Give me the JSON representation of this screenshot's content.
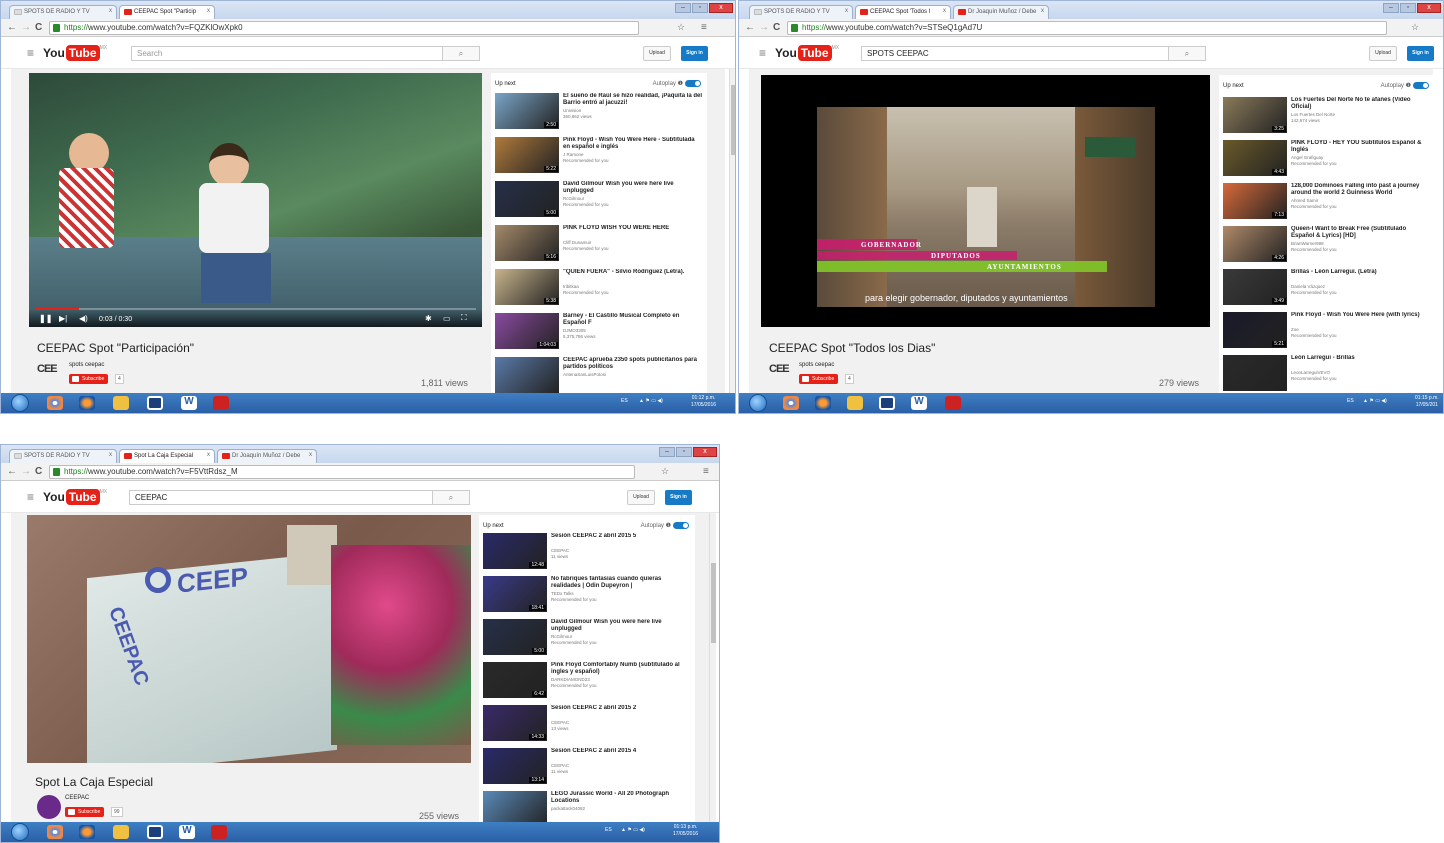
{
  "shot1": {
    "tabs": [
      "SPOTS DE RADIO Y TV",
      "CEEPAC Spot \"Particip"
    ],
    "url_https": "https://",
    "url_rest": "www.youtube.com/watch?v=FQZKlOwXpk0",
    "search_placeholder": "Search",
    "search_button_icon": "search-icon",
    "logo_you": "You",
    "logo_tube": "Tube",
    "logo_region": "MX",
    "upload": "Upload",
    "signin": "Sign in",
    "player": {
      "time": "0:03 / 0:30",
      "progress": 0.1
    },
    "video_title": "CEEPAC Spot \"Participación\"",
    "channel_logo": "CEE",
    "channel": "spots ceepac",
    "subscribe": "Subscribe",
    "subscribers": "4",
    "views": "1,811 views",
    "up_next": "Up next",
    "autoplay": "Autoplay",
    "items": [
      {
        "title": "El sueño de Raúl se hizo realidad, ¡Paquita la del Barrio entró al jacuzzi!",
        "channel": "Univision",
        "meta": "360,862 views",
        "dur": "2:50",
        "color": "#7aa6c8"
      },
      {
        "title": "Pink Floyd - Wish You Were Here - Subtitulada en español e inglés",
        "channel": "J Ramone",
        "meta": "Recommended for you",
        "dur": "5:22",
        "color": "#b07a3c"
      },
      {
        "title": "David Gilmour Wish you were here live unplugged",
        "channel": "RcGilmour",
        "meta": "Recommended for you",
        "dur": "5:00",
        "color": "#27304a"
      },
      {
        "title": "PINK FLOYD WISH YOU WERE HERE",
        "channel": "Cliff Dunamuir",
        "meta": "Recommended for you",
        "dur": "5:16",
        "color": "#a48a6a"
      },
      {
        "title": "\"QUIEN FUERA\" - Silvio Rodríguez (Letra).",
        "channel": "tribitkaa",
        "meta": "Recommended for you",
        "dur": "5:38",
        "color": "#c8b48c"
      },
      {
        "title": "Barney - El Castillo Musical Completo en Español F",
        "channel": "DJMO3305",
        "meta": "5,375,786 views",
        "dur": "1:04:03",
        "color": "#8a4aa0"
      },
      {
        "title": "CEEPAC aprueba 2350 spots publicitarios para partidos políticos",
        "channel": "AntenaSanLuisPotosi",
        "meta": "",
        "dur": "",
        "color": "#5a7aa8"
      }
    ],
    "tray": "ES",
    "clock_time": "01:12 p.m.",
    "clock_date": "17/05/2016"
  },
  "shot2": {
    "tabs": [
      "SPOTS DE RADIO Y TV",
      "CEEPAC Spot 'Todos l",
      "Dr Joaquín Muñoz / Debe"
    ],
    "url_https": "https://",
    "url_rest": "www.youtube.com/watch?v=STSeQ1gAd7U",
    "search_value": "SPOTS CEEPAC",
    "upload": "Upload",
    "signin": "Sign in",
    "overlay": {
      "l1": "GOBERNADOR",
      "l2": "DIPUTADOS",
      "l3": "AYUNTAMIENTOS",
      "subtitle": "para elegir gobernador, diputados y ayuntamientos"
    },
    "video_title": "CEEPAC Spot \"Todos los Dias\"",
    "channel_logo": "CEE",
    "channel": "spots ceepac",
    "subscribe": "Subscribe",
    "subscribers": "4",
    "views": "279 views",
    "up_next": "Up next",
    "autoplay": "Autoplay",
    "items": [
      {
        "title": "Los Fuertes Del Norte No te afanes (Video Oficial)",
        "channel": "Los Fuertes Del Norte",
        "meta": "142,674 views",
        "dur": "3:25",
        "color": "#8a7a5a"
      },
      {
        "title": "PINK FLOYD - HEY YOU Subtitulos Español & Inglés",
        "channel": "Angel Grafiguay",
        "meta": "Recommended for you",
        "dur": "4:43",
        "color": "#6a5a2a"
      },
      {
        "title": "128,000 Dominoes Falling into past a journey around the world 2 Guinness World",
        "channel": "Ahmed Samir",
        "meta": "Recommended for you",
        "dur": "7:13",
        "color": "#d86a3a"
      },
      {
        "title": "Queen-I Want to Break Free (Subtitulado Español & Lyrics) [HD]",
        "channel": "BrianWarner998",
        "meta": "Recommended for you",
        "dur": "4:26",
        "color": "#b08a6a"
      },
      {
        "title": "Brillas - León Larregui. (Letra)",
        "channel": "Daniela Vázquez",
        "meta": "Recommended for you",
        "dur": "3:49",
        "color": "#3a3a3a"
      },
      {
        "title": "Pink Floyd - Wish You Were Here (with lyrics)",
        "channel": "Zoe",
        "meta": "Recommended for you",
        "dur": "5:21",
        "color": "#1a1a2a"
      },
      {
        "title": "León Larregui - Brillas",
        "channel": "LeonLarreguiVEVO",
        "meta": "Recommended for you",
        "dur": "",
        "color": "#2a2a2a"
      }
    ],
    "tray": "ES",
    "clock_time": "01:15 p.m.",
    "clock_date": "17/05/201"
  },
  "shot3": {
    "tabs": [
      "SPOTS DE RADIO Y TV",
      "Spot La Caja Especial",
      "Dr Joaquín Muñoz / Debe"
    ],
    "url_https": "https://",
    "url_rest": "www.youtube.com/watch?v=F5VttRdsz_M",
    "search_value": "CEEPAC",
    "upload": "Upload",
    "signin": "Sign in",
    "box_text": "CEEP",
    "box_side_text": "CEEPAC",
    "video_title": "Spot La Caja Especial",
    "channel": "CEEPAC",
    "subscribe": "Subscribe",
    "subscribers": "99",
    "views": "255 views",
    "up_next": "Up next",
    "autoplay": "Autoplay",
    "items": [
      {
        "title": "Sesión CEEPAC 2 abril 2015 5",
        "channel": "CEEPAC",
        "meta": "11 views",
        "dur": "12:48",
        "color": "#2a2a6a"
      },
      {
        "title": "No fabriques fantasías cuando quieras realidades | Odin Dupeyron |",
        "channel": "TEDx Talks",
        "meta": "Recommended for you",
        "dur": "18:41",
        "color": "#3a3a8a"
      },
      {
        "title": "David Gilmour Wish you were here live unplugged",
        "channel": "RcGilmour",
        "meta": "Recommended for you",
        "dur": "5:00",
        "color": "#27304a"
      },
      {
        "title": "Pink Floyd Comfortably Numb (subtitulado al ingles y español)",
        "channel": "DARKDIAMOND23",
        "meta": "Recommended for you",
        "dur": "6:42",
        "color": "#2a2a2a"
      },
      {
        "title": "Sesión CEEPAC 2 abril 2015 2",
        "channel": "CEEPAC",
        "meta": "13 views",
        "dur": "14:33",
        "color": "#3a2a6a"
      },
      {
        "title": "Sesión CEEPAC 2 abril 2015 4",
        "channel": "CEEPAC",
        "meta": "11 views",
        "dur": "13:14",
        "color": "#2a2a6a"
      },
      {
        "title": "LEGO Jurassic World - All 20 Photograph Locations",
        "channel": "packattack04082",
        "meta": "",
        "dur": "",
        "color": "#5a8ab8"
      }
    ],
    "tray": "ES",
    "clock_time": "01:13 p.m.",
    "clock_date": "17/05/2016"
  },
  "icons": {
    "back": "←",
    "forward": "→",
    "reload": "C",
    "menu": "≡",
    "search": "⌕",
    "play": "❚❚",
    "next": "▶|",
    "volume": "◀)",
    "settings": "✱",
    "theater": "▭",
    "fullscreen": "⛶"
  }
}
